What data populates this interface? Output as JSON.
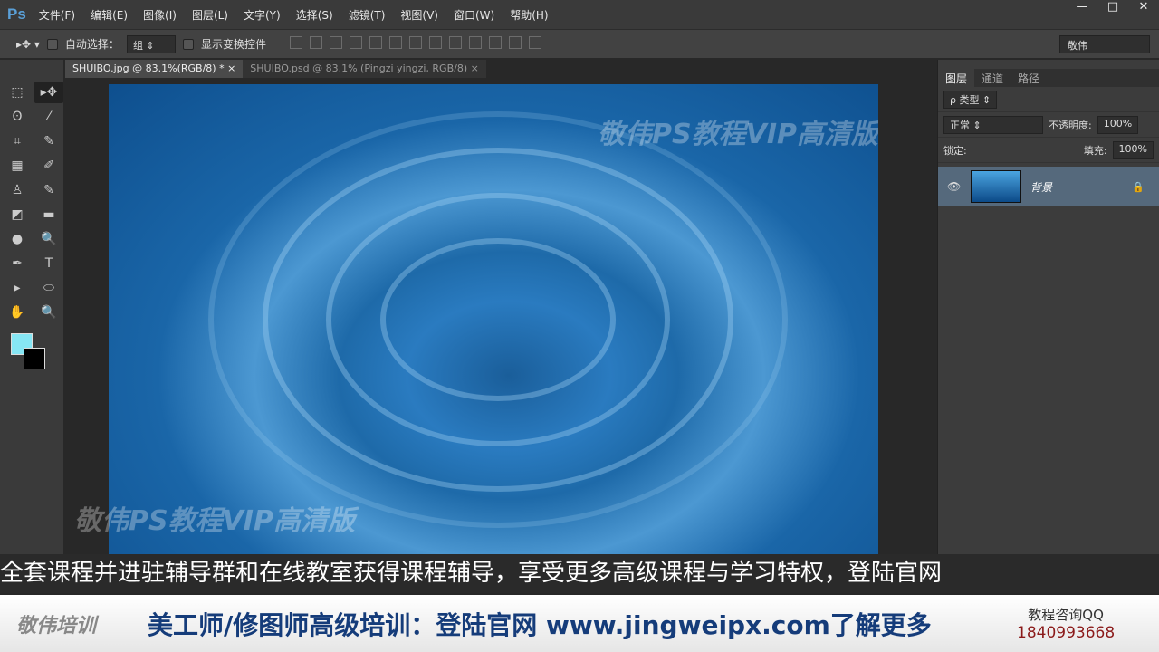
{
  "app": {
    "logo": "Ps",
    "menu": [
      "文件(F)",
      "编辑(E)",
      "图像(I)",
      "图层(L)",
      "文字(Y)",
      "选择(S)",
      "滤镜(T)",
      "视图(V)",
      "窗口(W)",
      "帮助(H)"
    ],
    "window_controls": [
      "—",
      "□",
      "✕"
    ]
  },
  "options": {
    "tool_icon": "▸✥ ▾",
    "auto_select_label": "自动选择：",
    "auto_select_value": "组 ⇕",
    "show_transform_label": "显示变换控件",
    "workspace": "敬伟"
  },
  "tabs": [
    {
      "label": "SHUIBO.jpg @ 83.1%(RGB/8) *",
      "close": "×"
    },
    {
      "label": "SHUIBO.psd @ 83.1% (Pingzi yingzi, RGB/8)",
      "close": "×"
    }
  ],
  "tools": [
    "⬚",
    "▸✥",
    "ʘ",
    "⁄",
    "⌗",
    "✎",
    "▦",
    "✐",
    "♙",
    "✎",
    "◩",
    "▬",
    "●",
    "🔍",
    "✒",
    "T",
    "▸",
    "⬭",
    "✋",
    "🔍"
  ],
  "colors": {
    "foreground": "#86e6f4",
    "background": "#000000"
  },
  "watermark": "敬伟PS教程VIP高清版",
  "layers_panel": {
    "tabs": [
      "图层",
      "通道",
      "路径"
    ],
    "filter": "ρ 类型 ⇕",
    "blend_mode": "正常 ⇕",
    "opacity_label": "不透明度:",
    "opacity": "100%",
    "lock_label": "锁定:",
    "fill_label": "填充:",
    "fill": "100%",
    "layers": [
      {
        "name": "背景",
        "visible_icon": "👁",
        "lock_icon": "🔒"
      }
    ]
  },
  "subtitle": "全套课程并进驻辅导群和在线教室获得课程辅导，享受更多高级课程与学习特权，登陆官网",
  "banner": {
    "brand": "敬伟培训",
    "promo": "美工师/修图师高级培训：登陆官网 www.jingweipx.com了解更多",
    "qq_label": "教程咨询QQ",
    "qq_number": "1840993668"
  }
}
